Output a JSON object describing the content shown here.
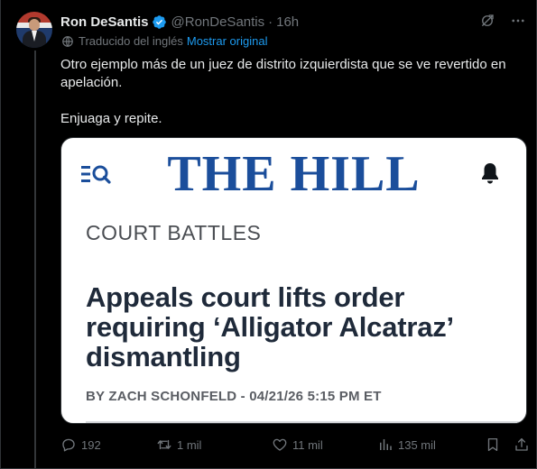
{
  "tweet": {
    "author_name": "Ron DeSantis",
    "handle": "@RonDeSantis",
    "separator": "·",
    "time": "16h",
    "translated_label": "Traducido del inglés",
    "show_original_label": "Mostrar original",
    "text_line1": "Otro ejemplo más de un juez de distrito izquierdista que se ve revertido en apelación.",
    "text_line2": "Enjuaga y repite."
  },
  "card": {
    "logo_text": "THE HILL",
    "section": "COURT BATTLES",
    "headline": "Appeals court lifts order requiring ‘Alligator Alcatraz’ dismantling",
    "byline": "BY ZACH SCHONFELD - 04/21/26 5:15 PM ET"
  },
  "actions": {
    "replies": "192",
    "retweets": "1 mil",
    "likes": "11 mil",
    "views": "135 mil"
  },
  "icons": {
    "verified": "verified-badge-icon",
    "grok": "grok-icon",
    "more": "more-icon",
    "globe": "globe-icon",
    "menu": "search-menu-icon",
    "bell": "bell-icon",
    "reply": "reply-icon",
    "retweet": "retweet-icon",
    "like": "heart-icon",
    "views": "views-icon",
    "bookmark": "bookmark-icon",
    "share": "share-icon"
  },
  "colors": {
    "background": "#000000",
    "text": "#e7e9ea",
    "muted": "#71767b",
    "link": "#1d9bf0",
    "hill_blue": "#1b4e9b"
  }
}
